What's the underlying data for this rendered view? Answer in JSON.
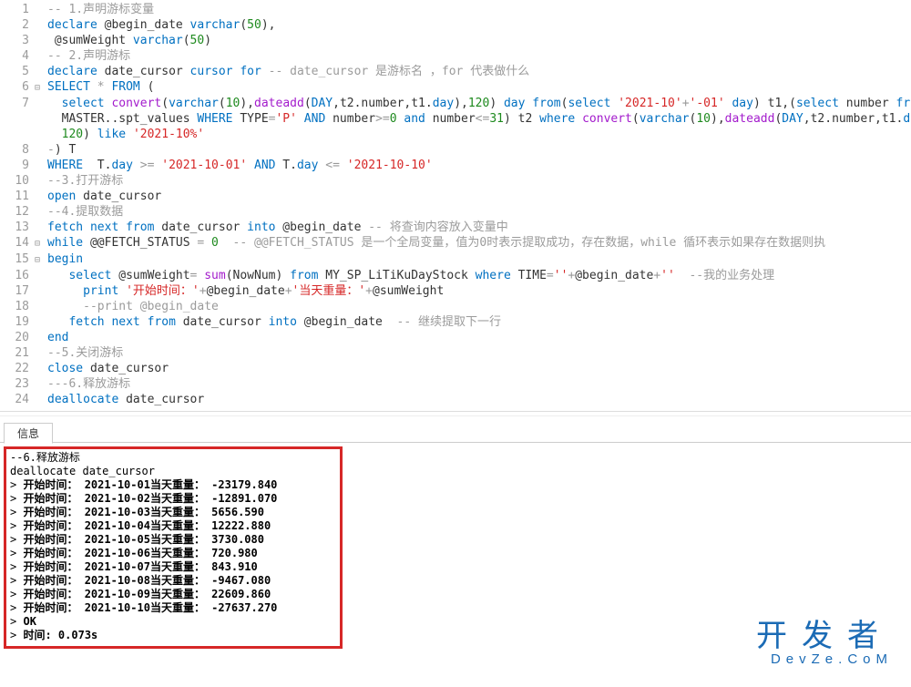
{
  "lines": [
    {
      "n": 1,
      "fold": "",
      "tokens": [
        [
          "cmt",
          "-- 1.声明游标变量"
        ]
      ]
    },
    {
      "n": 2,
      "fold": "",
      "tokens": [
        [
          "kw",
          "declare"
        ],
        [
          "id",
          " @begin_date "
        ],
        [
          "kw",
          "varchar"
        ],
        [
          "id",
          "("
        ],
        [
          "num",
          "50"
        ],
        [
          "id",
          "),"
        ]
      ]
    },
    {
      "n": 3,
      "fold": "",
      "tokens": [
        [
          "id",
          " @sumWeight "
        ],
        [
          "kw",
          "varchar"
        ],
        [
          "id",
          "("
        ],
        [
          "num",
          "50"
        ],
        [
          "id",
          ")"
        ]
      ]
    },
    {
      "n": 4,
      "fold": "",
      "tokens": [
        [
          "cmt",
          "-- 2.声明游标"
        ]
      ]
    },
    {
      "n": 5,
      "fold": "",
      "tokens": [
        [
          "kw",
          "declare"
        ],
        [
          "id",
          " date_cursor "
        ],
        [
          "kw",
          "cursor"
        ],
        [
          "id",
          " "
        ],
        [
          "kw",
          "for"
        ],
        [
          "id",
          " "
        ],
        [
          "cmt",
          "-- date_cursor 是游标名 ，for 代表做什么"
        ]
      ]
    },
    {
      "n": 6,
      "fold": "⊟",
      "tokens": [
        [
          "kw",
          "SELECT"
        ],
        [
          "id",
          " "
        ],
        [
          "op",
          "*"
        ],
        [
          "id",
          " "
        ],
        [
          "kw",
          "FROM"
        ],
        [
          "id",
          " ("
        ]
      ]
    },
    {
      "n": 7,
      "fold": "",
      "tokens": [
        [
          "id",
          "  "
        ],
        [
          "kw",
          "select"
        ],
        [
          "id",
          " "
        ],
        [
          "fn",
          "convert"
        ],
        [
          "id",
          "("
        ],
        [
          "kw",
          "varchar"
        ],
        [
          "id",
          "("
        ],
        [
          "num",
          "10"
        ],
        [
          "id",
          "),"
        ],
        [
          "fn",
          "dateadd"
        ],
        [
          "id",
          "("
        ],
        [
          "kw",
          "DAY"
        ],
        [
          "id",
          ",t2.number,t1."
        ],
        [
          "kw",
          "day"
        ],
        [
          "id",
          "),"
        ],
        [
          "num",
          "120"
        ],
        [
          "id",
          ") "
        ],
        [
          "kw",
          "day"
        ],
        [
          "id",
          " "
        ],
        [
          "kw",
          "from"
        ],
        [
          "id",
          "("
        ],
        [
          "kw",
          "select"
        ],
        [
          "id",
          " "
        ],
        [
          "str",
          "'2021-10'"
        ],
        [
          "op",
          "+"
        ],
        [
          "str",
          "'-01'"
        ],
        [
          "id",
          " "
        ],
        [
          "kw",
          "day"
        ],
        [
          "id",
          ") t1,("
        ],
        [
          "kw",
          "select"
        ],
        [
          "id",
          " number "
        ],
        [
          "kw",
          "from"
        ]
      ]
    },
    {
      "n": "",
      "fold": "",
      "tokens": [
        [
          "id",
          "  MASTER..spt_values "
        ],
        [
          "kw",
          "WHERE"
        ],
        [
          "id",
          " TYPE"
        ],
        [
          "op",
          "="
        ],
        [
          "str",
          "'P'"
        ],
        [
          "id",
          " "
        ],
        [
          "kw",
          "AND"
        ],
        [
          "id",
          " number"
        ],
        [
          "op",
          ">="
        ],
        [
          "num",
          "0"
        ],
        [
          "id",
          " "
        ],
        [
          "kw",
          "and"
        ],
        [
          "id",
          " number"
        ],
        [
          "op",
          "<="
        ],
        [
          "num",
          "31"
        ],
        [
          "id",
          ") t2 "
        ],
        [
          "kw",
          "where"
        ],
        [
          "id",
          " "
        ],
        [
          "fn",
          "convert"
        ],
        [
          "id",
          "("
        ],
        [
          "kw",
          "varchar"
        ],
        [
          "id",
          "("
        ],
        [
          "num",
          "10"
        ],
        [
          "id",
          "),"
        ],
        [
          "fn",
          "dateadd"
        ],
        [
          "id",
          "("
        ],
        [
          "kw",
          "DAY"
        ],
        [
          "id",
          ",t2.number,t1."
        ],
        [
          "kw",
          "day"
        ]
      ]
    },
    {
      "n": "",
      "fold": "",
      "tokens": [
        [
          "id",
          "  "
        ],
        [
          "num",
          "120"
        ],
        [
          "id",
          ") "
        ],
        [
          "kw",
          "like"
        ],
        [
          "id",
          " "
        ],
        [
          "str",
          "'2021-10%'"
        ]
      ]
    },
    {
      "n": 8,
      "fold": "",
      "tokens": [
        [
          "op",
          "-"
        ],
        [
          "id",
          ") T"
        ]
      ]
    },
    {
      "n": 9,
      "fold": "",
      "tokens": [
        [
          "kw",
          "WHERE"
        ],
        [
          "id",
          "  T."
        ],
        [
          "kw",
          "day"
        ],
        [
          "id",
          " "
        ],
        [
          "op",
          ">="
        ],
        [
          "id",
          " "
        ],
        [
          "str",
          "'2021-10-01'"
        ],
        [
          "id",
          " "
        ],
        [
          "kw",
          "AND"
        ],
        [
          "id",
          " T."
        ],
        [
          "kw",
          "day"
        ],
        [
          "id",
          " "
        ],
        [
          "op",
          "<="
        ],
        [
          "id",
          " "
        ],
        [
          "str",
          "'2021-10-10'"
        ]
      ]
    },
    {
      "n": 10,
      "fold": "",
      "tokens": [
        [
          "cmt",
          "--3.打开游标"
        ]
      ]
    },
    {
      "n": 11,
      "fold": "",
      "tokens": [
        [
          "kw",
          "open"
        ],
        [
          "id",
          " date_cursor"
        ]
      ]
    },
    {
      "n": 12,
      "fold": "",
      "tokens": [
        [
          "cmt",
          "--4.提取数据"
        ]
      ]
    },
    {
      "n": 13,
      "fold": "",
      "tokens": [
        [
          "kw",
          "fetch"
        ],
        [
          "id",
          " "
        ],
        [
          "kw",
          "next"
        ],
        [
          "id",
          " "
        ],
        [
          "kw",
          "from"
        ],
        [
          "id",
          " date_cursor "
        ],
        [
          "kw",
          "into"
        ],
        [
          "id",
          " @begin_date "
        ],
        [
          "cmt",
          "-- 将查询内容放入变量中"
        ]
      ]
    },
    {
      "n": 14,
      "fold": "⊟",
      "tokens": [
        [
          "kw",
          "while"
        ],
        [
          "id",
          " @@FETCH_STATUS "
        ],
        [
          "op",
          "="
        ],
        [
          "id",
          " "
        ],
        [
          "num",
          "0"
        ],
        [
          "id",
          "  "
        ],
        [
          "cmt",
          "-- @@FETCH_STATUS 是一个全局变量，值为0时表示提取成功，存在数据，while 循环表示如果存在数据则执"
        ]
      ]
    },
    {
      "n": 15,
      "fold": "⊟",
      "tokens": [
        [
          "kw",
          "begin"
        ]
      ]
    },
    {
      "n": 16,
      "fold": "",
      "tokens": [
        [
          "id",
          "   "
        ],
        [
          "kw",
          "select"
        ],
        [
          "id",
          " @sumWeight"
        ],
        [
          "op",
          "="
        ],
        [
          "id",
          " "
        ],
        [
          "fn",
          "sum"
        ],
        [
          "id",
          "(NowNum) "
        ],
        [
          "kw",
          "from"
        ],
        [
          "id",
          " MY_SP_LiTiKuDayStock "
        ],
        [
          "kw",
          "where"
        ],
        [
          "id",
          " TIME"
        ],
        [
          "op",
          "="
        ],
        [
          "str",
          "''"
        ],
        [
          "op",
          "+"
        ],
        [
          "id",
          "@begin_date"
        ],
        [
          "op",
          "+"
        ],
        [
          "str",
          "''"
        ],
        [
          "id",
          "  "
        ],
        [
          "cmt",
          "--我的业务处理"
        ]
      ]
    },
    {
      "n": 17,
      "fold": "",
      "tokens": [
        [
          "id",
          "     "
        ],
        [
          "kw",
          "print"
        ],
        [
          "id",
          " "
        ],
        [
          "str",
          "'开始时间：'"
        ],
        [
          "op",
          "+"
        ],
        [
          "id",
          "@begin_date"
        ],
        [
          "op",
          "+"
        ],
        [
          "str",
          "'当天重量：'"
        ],
        [
          "op",
          "+"
        ],
        [
          "id",
          "@sumWeight"
        ]
      ]
    },
    {
      "n": 18,
      "fold": "",
      "tokens": [
        [
          "id",
          "     "
        ],
        [
          "cmt",
          "--print @begin_date"
        ]
      ]
    },
    {
      "n": 19,
      "fold": "",
      "tokens": [
        [
          "id",
          "   "
        ],
        [
          "kw",
          "fetch"
        ],
        [
          "id",
          " "
        ],
        [
          "kw",
          "next"
        ],
        [
          "id",
          " "
        ],
        [
          "kw",
          "from"
        ],
        [
          "id",
          " date_cursor "
        ],
        [
          "kw",
          "into"
        ],
        [
          "id",
          " @begin_date  "
        ],
        [
          "cmt",
          "-- 继续提取下一行"
        ]
      ]
    },
    {
      "n": 20,
      "fold": "",
      "tokens": [
        [
          "kw",
          "end"
        ]
      ]
    },
    {
      "n": 21,
      "fold": "",
      "tokens": [
        [
          "cmt",
          "--5.关闭游标"
        ]
      ]
    },
    {
      "n": 22,
      "fold": "",
      "tokens": [
        [
          "kw",
          "close"
        ],
        [
          "id",
          " date_cursor"
        ]
      ]
    },
    {
      "n": 23,
      "fold": "",
      "tokens": [
        [
          "op",
          "-"
        ],
        [
          "cmt",
          "--6.释放游标"
        ]
      ]
    },
    {
      "n": 24,
      "fold": "",
      "tokens": [
        [
          "kw",
          "deallocate"
        ],
        [
          "id",
          " date_cursor"
        ]
      ]
    }
  ],
  "tab_label": "信息",
  "results_header": [
    "--6.释放游标",
    "deallocate date_cursor"
  ],
  "results": [
    {
      "date": "2021-10-01",
      "weight": "-23179.840"
    },
    {
      "date": "2021-10-02",
      "weight": "-12891.070"
    },
    {
      "date": "2021-10-03",
      "weight": "5656.590"
    },
    {
      "date": "2021-10-04",
      "weight": "12222.880"
    },
    {
      "date": "2021-10-05",
      "weight": "3730.080"
    },
    {
      "date": "2021-10-06",
      "weight": "720.980"
    },
    {
      "date": "2021-10-07",
      "weight": "843.910"
    },
    {
      "date": "2021-10-08",
      "weight": "-9467.080"
    },
    {
      "date": "2021-10-09",
      "weight": "22609.860"
    },
    {
      "date": "2021-10-10",
      "weight": "-27637.270"
    }
  ],
  "result_prefix": "开始时间：",
  "result_mid": "当天重量：",
  "result_ok": "OK",
  "result_time": "时间: 0.073s",
  "wm_big": "开发者",
  "wm_small": "DevZe.CoM"
}
